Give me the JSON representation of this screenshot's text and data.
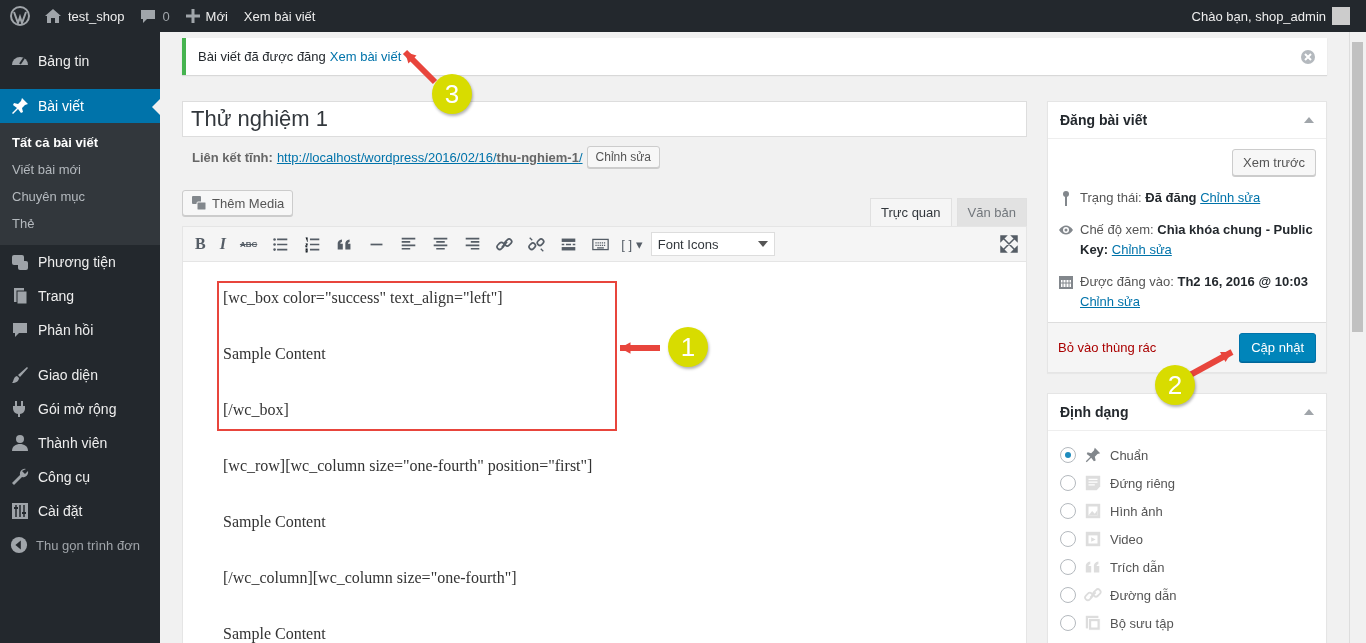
{
  "admin_bar": {
    "site": "test_shop",
    "comments": "0",
    "new": "Mới",
    "view": "Xem bài viết",
    "greeting": "Chào bạn, shop_admin"
  },
  "menu_groups": [
    [
      {
        "label": "Bảng tin",
        "selected": false
      }
    ],
    [
      {
        "label": "Bài viết",
        "selected": true,
        "children": [
          {
            "label": "Tất cả bài viết",
            "selected": true
          },
          {
            "label": "Viết bài mới",
            "selected": false
          },
          {
            "label": "Chuyên mục",
            "selected": false
          },
          {
            "label": "Thẻ",
            "selected": false
          }
        ]
      },
      {
        "label": "Phương tiện",
        "selected": false
      },
      {
        "label": "Trang",
        "selected": false
      },
      {
        "label": "Phản hồi",
        "selected": false
      }
    ],
    [
      {
        "label": "Giao diện",
        "selected": false
      },
      {
        "label": "Gói mở rộng",
        "selected": false
      },
      {
        "label": "Thành viên",
        "selected": false
      },
      {
        "label": "Công cụ",
        "selected": false
      },
      {
        "label": "Cài đặt",
        "selected": false
      }
    ]
  ],
  "collapse_menu": "Thu gọn trình đơn",
  "notice": {
    "text": "Bài viết đã được đăng",
    "link": "Xem bài viết"
  },
  "post": {
    "title": "Thử nghiệm 1",
    "permalink_label": "Liên kết tĩnh:",
    "permalink": "http://localhost/wordpress/2016/02/16/**thu-nghiem-1**/",
    "edit_button": "Chỉnh sửa"
  },
  "editor": {
    "add_media": "Thêm Media",
    "tabs": [
      {
        "label": "Trực quan",
        "selected": true
      },
      {
        "label": "Văn bản",
        "selected": false
      }
    ],
    "toolbar": [
      {
        "kind": "text",
        "label": "B"
      },
      {
        "kind": "italic",
        "label": "I"
      },
      {
        "kind": "strike",
        "label": "ABC"
      },
      {
        "kind": "bullist"
      },
      {
        "kind": "numlist"
      },
      {
        "kind": "quote"
      },
      {
        "kind": "hr"
      },
      {
        "kind": "alignleft"
      },
      {
        "kind": "aligncenter"
      },
      {
        "kind": "alignright"
      },
      {
        "kind": "link"
      },
      {
        "kind": "unlink"
      },
      {
        "kind": "more"
      },
      {
        "kind": "keyboard"
      },
      {
        "kind": "shortcode",
        "label": "[ ]",
        "caret": "▾"
      },
      {
        "kind": "select",
        "label": "Font Icons"
      }
    ],
    "paragraphs": [
      "[wc_box color=\"success\" text_align=\"left\"]",
      "Sample Content",
      "[/wc_box]",
      "[wc_row][wc_column size=\"one-fourth\" position=\"first\"]",
      "Sample Content",
      "[/wc_column][wc_column size=\"one-fourth\"]",
      "Sample Content"
    ]
  },
  "publish_box": {
    "title": "Đăng bài viết",
    "preview": "Xem trước",
    "rows": [
      {
        "text": "Trạng thái: **Đã đăng**",
        "link": "Chỉnh sửa"
      },
      {
        "text": "Chế độ xem: **Chìa khóa chung - Public Key:**",
        "link": "Chỉnh sửa"
      },
      {
        "text": "Được đăng vào: **Th2 16, 2016 @ 10:03**",
        "link": "Chỉnh sửa"
      }
    ],
    "trash": "Bỏ vào thùng rác",
    "update": "Cập nhật"
  },
  "format_box": {
    "title": "Định dạng",
    "options": [
      {
        "label": "Chuẩn",
        "selected": true
      },
      {
        "label": "Đứng riêng",
        "selected": false
      },
      {
        "label": "Hình ảnh",
        "selected": false
      },
      {
        "label": "Video",
        "selected": false
      },
      {
        "label": "Trích dẫn",
        "selected": false
      },
      {
        "label": "Đường dẫn",
        "selected": false
      },
      {
        "label": "Bộ sưu tập",
        "selected": false
      }
    ]
  },
  "annotations": [
    {
      "number": "1"
    },
    {
      "number": "2"
    },
    {
      "number": "3"
    }
  ]
}
